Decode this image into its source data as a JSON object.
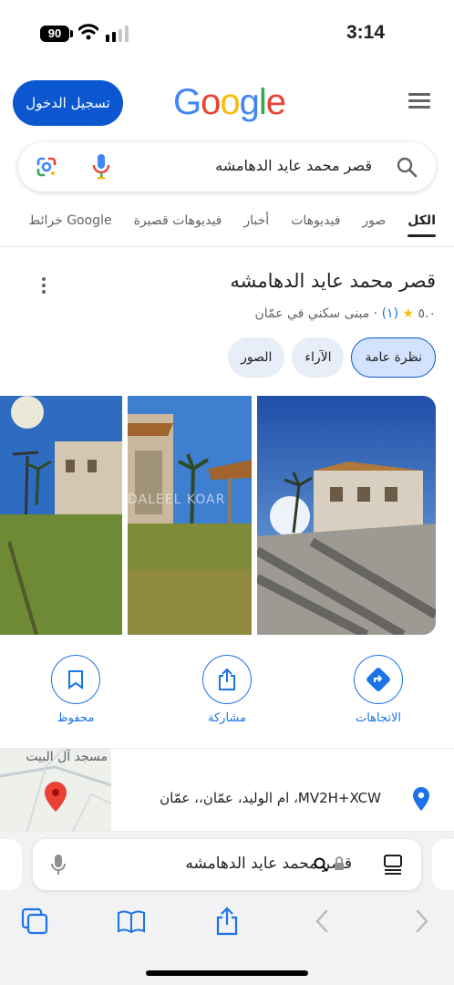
{
  "status": {
    "time": "3:14",
    "battery": "90"
  },
  "header": {
    "login_label": "تسجيل الدخول",
    "logo": "Google"
  },
  "search": {
    "query": "قصر محمد عايد الدهامشه"
  },
  "tabs": [
    {
      "label": "الكل",
      "active": true
    },
    {
      "label": "صور"
    },
    {
      "label": "فيديوهات"
    },
    {
      "label": "أخبار"
    },
    {
      "label": "فيديوهات قصيرة"
    },
    {
      "label": "خرائط"
    },
    {
      "label": "Google"
    }
  ],
  "place": {
    "title": "قصر محمد عايد الدهامشه",
    "rating": "٥.٠",
    "reviews": "(١)",
    "category": "مبنى سكني في عمّان",
    "chips": [
      {
        "label": "نظرة عامة",
        "active": true
      },
      {
        "label": "الآراء"
      },
      {
        "label": "الصور"
      }
    ]
  },
  "photos": {
    "watermark": "DALEEL KOAR"
  },
  "actions": [
    {
      "label": "الاتجاهات",
      "icon": "directions-icon"
    },
    {
      "label": "مشاركة",
      "icon": "share-icon"
    },
    {
      "label": "محفوظ",
      "icon": "bookmark-icon"
    }
  ],
  "address": {
    "text": "MV2H+XCW، ام الوليد، عمّان،، عمّان",
    "map_label": "مسجد آل البيت"
  },
  "browser": {
    "url_text": "قصر محمد عايد الدهامشه"
  },
  "colors": {
    "accent": "#1a73e8",
    "login_bg": "#0b57d0",
    "pin": "#ea4335"
  }
}
